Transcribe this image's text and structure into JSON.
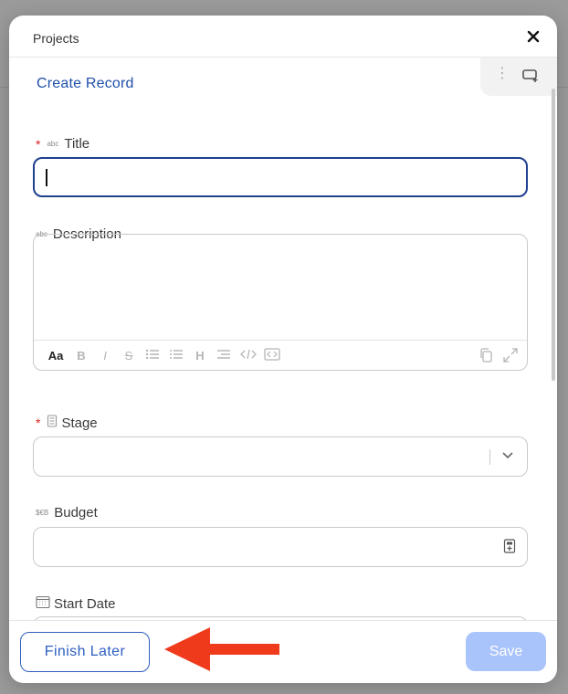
{
  "modal": {
    "title": "Projects",
    "close_glyph": "✕",
    "section_title": "Create Record",
    "toolbar": {
      "more_icon": "kebab-icon",
      "add_icon": "add-window-icon"
    }
  },
  "fields": {
    "title": {
      "label": "Title",
      "type_badge": "abc",
      "required": true,
      "value": ""
    },
    "description": {
      "label": "Description",
      "type_badge": "abc",
      "required": false,
      "value": ""
    },
    "stage": {
      "label": "Stage",
      "required": true,
      "value": ""
    },
    "budget": {
      "label": "Budget",
      "type_badge": "$€B",
      "required": false,
      "value": ""
    },
    "start_date": {
      "label": "Start Date",
      "required": false,
      "value": ""
    }
  },
  "editor_toolbar": {
    "aa": "Aa",
    "bold": "B",
    "italic": "I",
    "strike": "S",
    "heading": "H"
  },
  "footer": {
    "finish_later": "Finish Later",
    "save": "Save"
  },
  "colors": {
    "accent": "#2e5fc1",
    "save_disabled": "#a9c3fb",
    "required": "#e02020",
    "arrow": "#f03a1c"
  }
}
